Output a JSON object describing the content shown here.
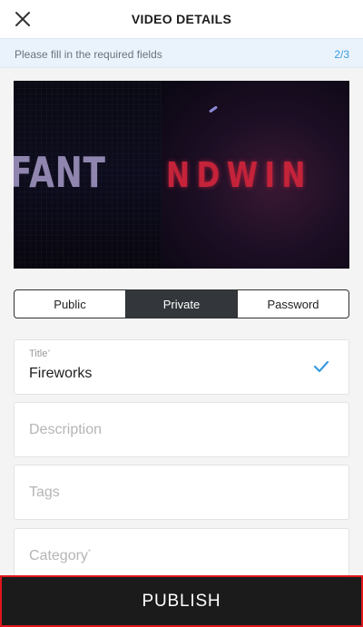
{
  "header": {
    "title": "VIDEO DETAILS",
    "close_icon": "close-icon"
  },
  "banner": {
    "message": "Please fill in the required fields",
    "step": "2/3"
  },
  "video": {
    "frame_text_left": "FANT",
    "frame_text_right": "NDWIN"
  },
  "privacy": {
    "options": [
      "Public",
      "Private",
      "Password"
    ],
    "selected": "Private"
  },
  "form": {
    "title": {
      "label": "Title",
      "required_mark": "*",
      "value": "Fireworks",
      "valid_icon": "check-icon"
    },
    "description": {
      "placeholder": "Description"
    },
    "tags": {
      "placeholder": "Tags"
    },
    "category": {
      "placeholder": "Category",
      "required_mark": "*"
    }
  },
  "footer": {
    "publish_label": "PUBLISH"
  },
  "colors": {
    "accent": "#3a9be0",
    "banner_bg": "#eaf3fb",
    "segment_active": "#33373b",
    "publish_bg": "#1b1b1b",
    "publish_border": "#e0161c"
  }
}
